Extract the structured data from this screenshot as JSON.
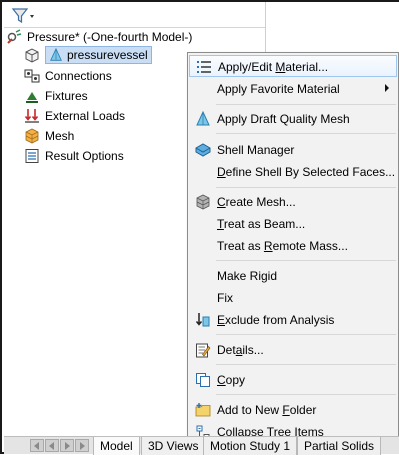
{
  "tree": {
    "study_label": "Pressure* (-One-fourth Model-)",
    "part_label": "pressurevessel",
    "items": [
      {
        "label": "Connections"
      },
      {
        "label": "Fixtures"
      },
      {
        "label": "External Loads"
      },
      {
        "label": "Mesh"
      },
      {
        "label": "Result Options"
      }
    ]
  },
  "context_menu": {
    "apply_edit_material": {
      "pre": "Apply/Edit ",
      "key": "M",
      "post": "aterial..."
    },
    "apply_favorite_material": "Apply Favorite Material",
    "apply_draft_mesh": "Apply Draft Quality Mesh",
    "shell_manager": "Shell Manager",
    "define_shell": {
      "key": "D",
      "post": "efine Shell By Selected Faces..."
    },
    "create_mesh": {
      "pre": "",
      "key": "C",
      "post": "reate Mesh..."
    },
    "treat_as_beam": {
      "pre": "",
      "key": "T",
      "post": "reat as Beam..."
    },
    "treat_as_remote_mass": {
      "pre": "Treat as ",
      "key": "R",
      "post": "emote Mass..."
    },
    "make_rigid": "Make Rigid",
    "fix": "Fix",
    "exclude_from_analysis": {
      "pre": "",
      "key": "E",
      "post": "xclude from Analysis"
    },
    "details": {
      "pre": "Det",
      "key": "a",
      "post": "ils..."
    },
    "copy": {
      "pre": "",
      "key": "C",
      "post": "opy"
    },
    "add_to_new_folder": {
      "pre": "Add to New ",
      "key": "F",
      "post": "older"
    },
    "collapse_tree_items": "Collapse Tree Items"
  },
  "bottom_tabs": {
    "model": "Model",
    "views_3d": "3D Views",
    "motion_study": "Motion Study 1",
    "partial_solids": "Partial Solids"
  }
}
